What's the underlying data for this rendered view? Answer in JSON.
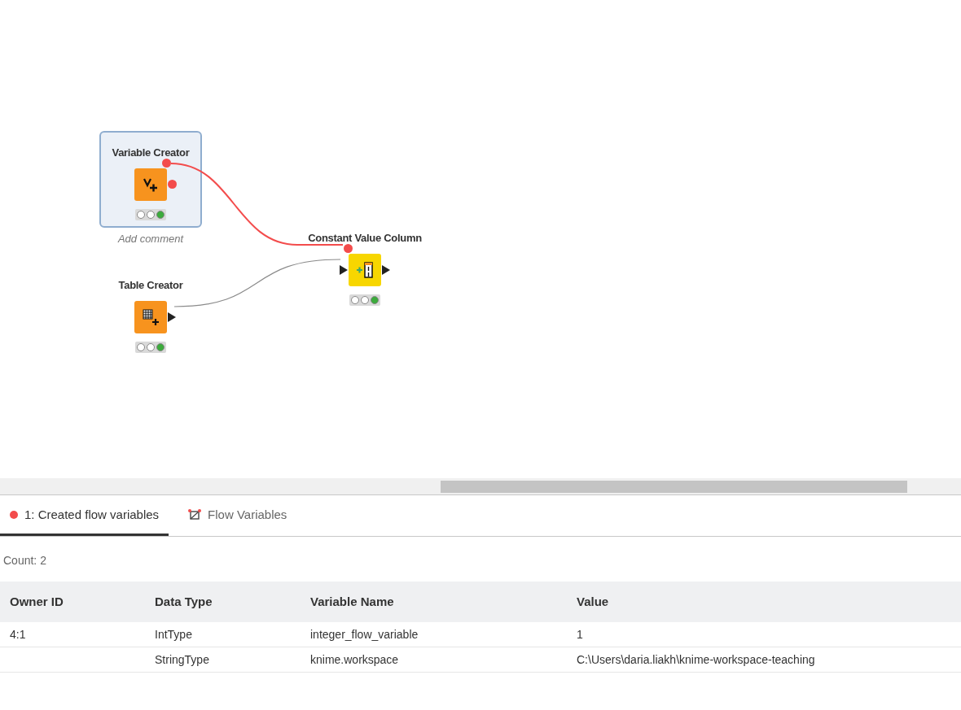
{
  "workflow": {
    "nodes": [
      {
        "title": "Variable Creator",
        "kind": "variable",
        "color": "#f7931e",
        "selected": true,
        "comment": "Add comment",
        "lights": [
          {
            "on": false
          },
          {
            "on": false
          },
          {
            "on": true
          }
        ]
      },
      {
        "title": "Table Creator",
        "kind": "table",
        "color": "#f7931e",
        "selected": false,
        "lights": [
          {
            "on": false
          },
          {
            "on": false
          },
          {
            "on": true
          }
        ]
      },
      {
        "title": "Constant Value Column",
        "kind": "manipulator",
        "color": "#f7d600",
        "selected": false,
        "lights": [
          {
            "on": false
          },
          {
            "on": false
          },
          {
            "on": true
          }
        ]
      }
    ],
    "connections": [
      {
        "kind": "variable"
      },
      {
        "kind": "data"
      }
    ]
  },
  "tabs": [
    {
      "label": "1: Created flow variables",
      "kind": "port",
      "selected": true
    },
    {
      "label": "Flow Variables",
      "kind": "variables",
      "selected": false
    }
  ],
  "count": "Count: 2",
  "table": {
    "columns": [
      "Owner ID",
      "Data Type",
      "Variable Name",
      "Value"
    ],
    "rows": [
      [
        "4:1",
        "IntType",
        "integer_flow_variable",
        "1"
      ],
      [
        "",
        "StringType",
        "knime.workspace",
        "C:\\Users\\daria.liakh\\knime-workspace-teaching"
      ]
    ]
  }
}
